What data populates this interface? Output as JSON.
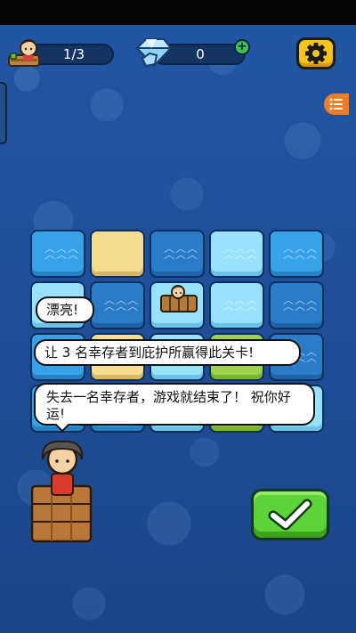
{
  "hud": {
    "survivors": "1/3",
    "gems": "0",
    "plus_icon": "plus-icon",
    "settings_icon": "gear-icon",
    "menu_icon": "list-icon"
  },
  "board": {
    "rows": [
      [
        "water",
        "sand",
        "deep",
        "ice",
        "water"
      ],
      [
        "ice",
        "deep",
        "ice",
        "ice",
        "deep"
      ],
      [
        "water",
        "sand",
        "ice",
        "grass",
        "deep"
      ],
      [
        "water",
        "water",
        "ice",
        "grass",
        "ice"
      ]
    ]
  },
  "bubbles": {
    "first": "漂亮!",
    "second": "让 3 名幸存者到庇护所赢得此关卡!",
    "third": "失去一名幸存者，游戏就结束了！ 祝你好运!"
  },
  "colors": {
    "sea": "#1d4f95",
    "settings_button": "#f6c31a",
    "confirm_button": "#5ed337",
    "menu_button": "#f07b2b"
  }
}
